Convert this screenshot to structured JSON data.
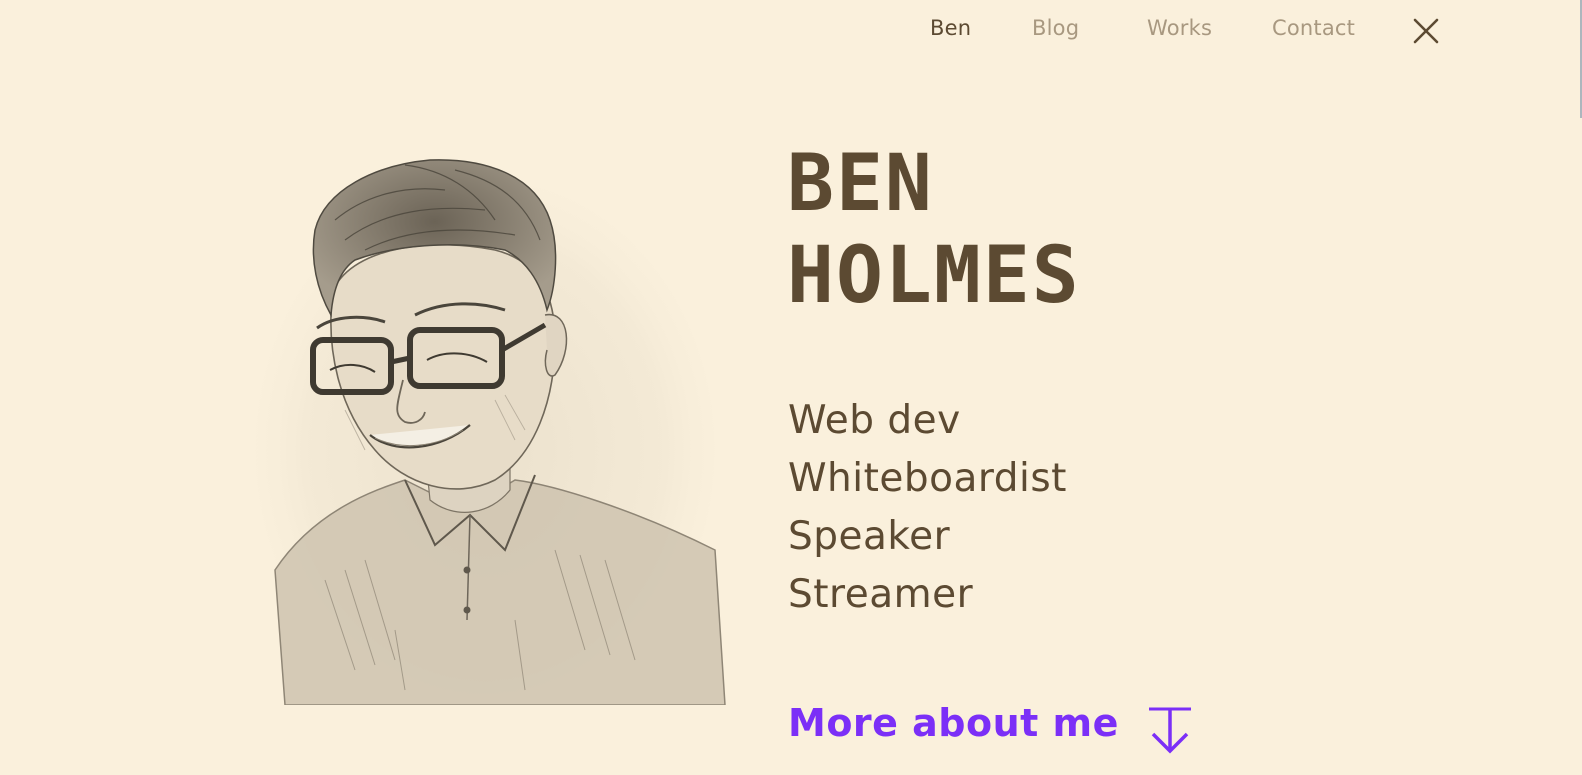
{
  "nav": {
    "items": [
      {
        "label": "Ben",
        "active": true
      },
      {
        "label": "Blog",
        "active": false
      },
      {
        "label": "Works",
        "active": false
      },
      {
        "label": "Contact",
        "active": false
      }
    ],
    "close_icon": "close-icon"
  },
  "hero": {
    "name_line1": "BEN",
    "name_line2": "HOLMES",
    "roles": [
      "Web dev",
      "Whiteboardist",
      "Speaker",
      "Streamer"
    ],
    "cta_label": "More about me",
    "cta_icon": "arrow-down-icon"
  },
  "colors": {
    "background": "#faf0dc",
    "text": "#5c4a32",
    "muted": "#a89880",
    "accent": "#7b2ff7"
  }
}
